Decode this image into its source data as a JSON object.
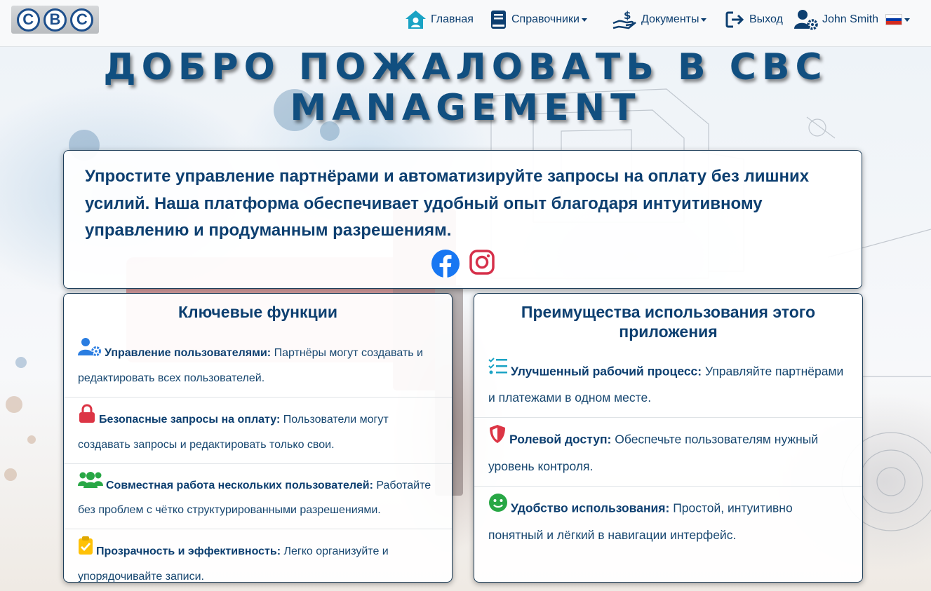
{
  "nav": {
    "logo_letters": [
      "C",
      "B",
      "C"
    ],
    "home_label": "Главная",
    "directories_label": "Справочники",
    "documents_label": "Документы",
    "logout_label": "Выход",
    "user_name": "John Smith",
    "home_icon": "home-user-icon",
    "directories_icon": "book-icon",
    "documents_icon": "hand-money-icon",
    "logout_icon": "sign-out-icon",
    "user_icon": "user-gear-icon",
    "language_flag": "russian-flag"
  },
  "hero": {
    "title_line1": "ДОБРО ПОЖАЛОВАТЬ В CBC",
    "title_line2": "MANAGEMENT"
  },
  "intro": {
    "text": "Упростите управление партнёрами и автоматизируйте запросы на оплату без лишних усилий. Наша платформа обеспечивает удобный опыт благодаря интуитивному управлению и продуманным разрешениям.",
    "social": [
      "facebook-icon",
      "instagram-icon"
    ]
  },
  "key_features": {
    "title": "Ключевые функции",
    "items": [
      {
        "icon": "users-gear-icon",
        "title": "Управление пользователями:",
        "text": "Партнёры могут создавать и редактировать всех пользователей."
      },
      {
        "icon": "lock-icon",
        "title": "Безопасные запросы на оплату:",
        "text": "Пользователи могут создавать запросы и редактировать только свои."
      },
      {
        "icon": "users-icon",
        "title": "Совместная работа нескольких пользователей:",
        "text": "Работайте без проблем с чётко структурированными разрешениями."
      },
      {
        "icon": "clipboard-check-icon",
        "title": "Прозрачность и эффективность:",
        "text": "Легко организуйте и упорядочивайте записи."
      }
    ]
  },
  "benefits": {
    "title": "Преимущества использования этого приложения",
    "items": [
      {
        "icon": "list-check-icon",
        "title": "Улучшенный рабочий процесс:",
        "text": "Управляйте партнёрами и платежами в одном месте."
      },
      {
        "icon": "shield-icon",
        "title": "Ролевой доступ:",
        "text": "Обеспечьте пользователям нужный уровень контроля."
      },
      {
        "icon": "smile-icon",
        "title": "Удобство использования:",
        "text": "Простой, интуитивно понятный и лёгкий в навигации интерфейс."
      }
    ]
  },
  "colors": {
    "primary": "#0d3f70",
    "teal_icon": "#1aa3c4",
    "lock": "#dc3545",
    "users": "#28a745",
    "clipboard": "#ffc107",
    "user_gear": "#2a7de1"
  }
}
